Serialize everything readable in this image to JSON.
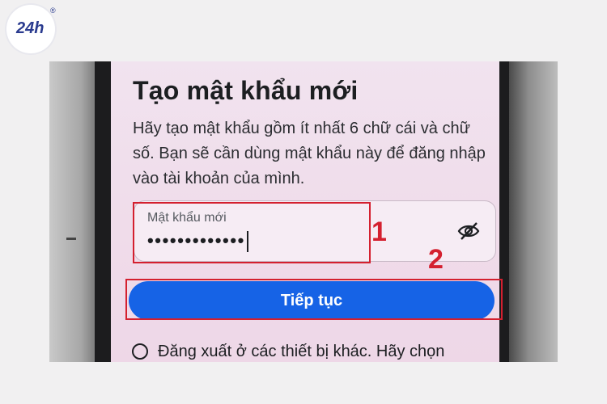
{
  "logo": {
    "text": "24h",
    "registered": "®"
  },
  "screen": {
    "title": "Tạo mật khẩu mới",
    "description": "Hãy tạo mật khẩu gồm ít nhất 6 chữ cái và chữ số. Bạn sẽ cần dùng mật khẩu này để đăng nhập vào tài khoản của mình.",
    "password_field": {
      "label": "Mật khẩu mới",
      "masked_value": "•••••••••••••"
    },
    "continue_button": "Tiếp tục",
    "logout_option": "Đăng xuất ở các thiết bị khác. Hãy chọn"
  },
  "annotations": {
    "step1": "1",
    "step2": "2",
    "highlight_color": "#d4202f"
  },
  "icons": [
    "eye-slash-icon",
    "radio-unchecked-icon"
  ],
  "colors": {
    "button": "#1663e6",
    "screen_bg": "#f0dcea"
  }
}
